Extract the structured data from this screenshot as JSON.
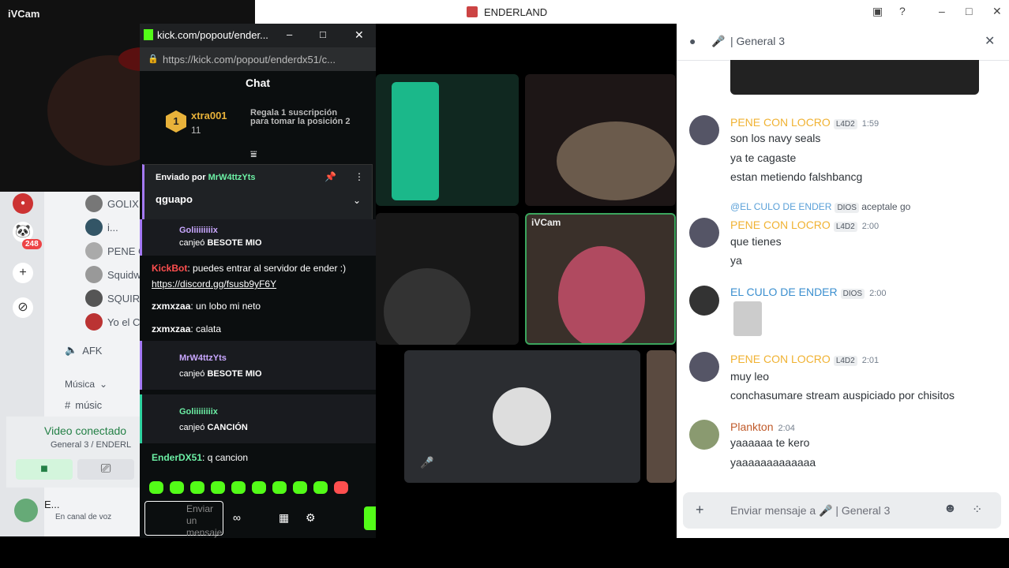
{
  "app": {
    "window_title": "ENDERLAND"
  },
  "ivcam": {
    "label": "iVCam"
  },
  "kick": {
    "tab_title": "kick.com/popout/ender...",
    "url": "https://kick.com/popout/enderdx51/c...",
    "chat_title": "Chat",
    "leaderboard": {
      "rank": "1",
      "user": "xtra001",
      "count": "11",
      "promo": "Regala 1 suscripción para tomar la posición 2"
    },
    "pinned": {
      "label": "Enviado por",
      "user": "MrW4ttzYts",
      "text": "qguapo"
    },
    "messages": [
      {
        "user": "Goliiiiiiiix",
        "text": "canjeó",
        "bold": "BESOTE MIO"
      },
      {
        "user": "KickBot",
        "text": "puedes entrar al servidor de ender :)",
        "link": "https://discord.gg/fsusb9yF6Y"
      },
      {
        "user": "zxmxzaa",
        "text": "un lobo mi neto"
      },
      {
        "user": "zxmxzaa",
        "text": "calata"
      },
      {
        "user": "MrW4ttzYts",
        "text": "canjeó",
        "bold": "BESOTE MIO"
      },
      {
        "user": "Goliiiiiiiix",
        "text": "canjeó",
        "bold": "CANCIÓN"
      },
      {
        "user": "EnderDX51",
        "text": "q cancion"
      }
    ],
    "input_placeholder": "Enviar un mensaje"
  },
  "grid": {
    "ivcam_label": "iVCam"
  },
  "sidebar": {
    "badge": "248",
    "members": [
      "GOLIX",
      "i...",
      "PENE C",
      "Squidw",
      "SQUIRT",
      "Yo el C"
    ],
    "afk": "AFK",
    "music": "Música",
    "music_channel": "músic",
    "voice_status": "Video conectado",
    "voice_channel": "General 3 / ENDERL",
    "user": "E...",
    "user_status": "En canal de voz"
  },
  "panel": {
    "channel": "General 3",
    "messages": [
      {
        "user": "PENE CON LOCRO",
        "tag": "L4D2",
        "time": "1:59",
        "lines": [
          "son los navy seals",
          "ya te cagaste",
          "estan metiendo falshbancg"
        ]
      },
      {
        "reply_user": "@EL CULO DE ENDER",
        "reply_tag": "DIOS",
        "reply_text": "aceptale go",
        "user": "PENE CON LOCRO",
        "tag": "L4D2",
        "time": "2:00",
        "lines": [
          "que tienes",
          "ya"
        ]
      },
      {
        "user": "EL CULO DE ENDER",
        "tag": "DIOS",
        "time": "2:00",
        "lines": []
      },
      {
        "user": "PENE CON LOCRO",
        "tag": "L4D2",
        "time": "2:01",
        "lines": [
          "muy leo",
          "conchasumare stream auspiciado por chisitos"
        ]
      },
      {
        "user": "Plankton",
        "tag": "",
        "time": "2:04",
        "lines": [
          "yaaaaaa te kero",
          "yaaaaaaaaaaaaa"
        ]
      }
    ],
    "input_placeholder": "Enviar mensaje a",
    "input_channel": "General 3"
  }
}
